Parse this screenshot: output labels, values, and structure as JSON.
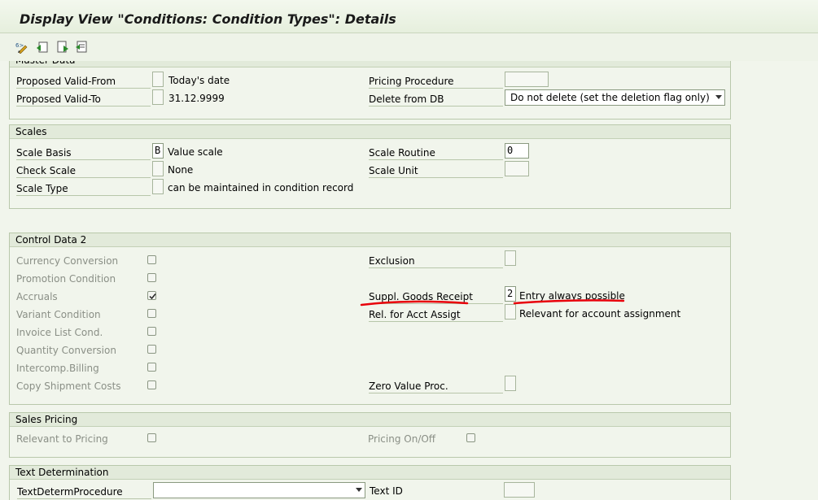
{
  "title": "Display View \"Conditions: Condition Types\": Details",
  "toolbar": {
    "icons": [
      "display-change-icon",
      "undo-icon",
      "next-entry-icon",
      "previous-entry-icon"
    ]
  },
  "master_data": {
    "header": "Master Data",
    "proposed_valid_from": {
      "label": "Proposed Valid-From",
      "value": "",
      "text": "Today's date"
    },
    "proposed_valid_to": {
      "label": "Proposed Valid-To",
      "value": "",
      "text": "31.12.9999"
    },
    "pricing_procedure": {
      "label": "Pricing Procedure",
      "value": ""
    },
    "delete_from_db": {
      "label": "Delete from DB",
      "value": "Do not delete (set the deletion flag only)"
    }
  },
  "scales": {
    "header": "Scales",
    "scale_basis": {
      "label": "Scale Basis",
      "value": "B",
      "text": "Value scale"
    },
    "check_scale": {
      "label": "Check Scale",
      "value": "",
      "text": "None"
    },
    "scale_type": {
      "label": "Scale Type",
      "value": "",
      "text": "can be maintained in condition record"
    },
    "scale_routine": {
      "label": "Scale Routine",
      "value": "0"
    },
    "scale_unit": {
      "label": "Scale Unit",
      "value": ""
    }
  },
  "control_data_2": {
    "header": "Control Data 2",
    "checkboxes": [
      {
        "label": "Currency Conversion",
        "checked": false
      },
      {
        "label": "Promotion Condition",
        "checked": false
      },
      {
        "label": "Accruals",
        "checked": true
      },
      {
        "label": "Variant Condition",
        "checked": false
      },
      {
        "label": "Invoice List Cond.",
        "checked": false
      },
      {
        "label": "Quantity Conversion",
        "checked": false
      },
      {
        "label": "Intercomp.Billing",
        "checked": false
      },
      {
        "label": "Copy Shipment Costs",
        "checked": false
      }
    ],
    "exclusion": {
      "label": "Exclusion",
      "value": ""
    },
    "suppl_goods_receipt": {
      "label": "Suppl. Goods Receipt",
      "value": "2",
      "text": "Entry always possible"
    },
    "rel_acct_assigt": {
      "label": "Rel. for Acct Assigt",
      "value": "",
      "text": "Relevant for account assignment"
    },
    "zero_value_proc": {
      "label": "Zero Value Proc.",
      "value": ""
    },
    "annotation_color": "#e8000a"
  },
  "sales_pricing": {
    "header": "Sales Pricing",
    "relevant_to_pricing": {
      "label": "Relevant to Pricing",
      "checked": false
    },
    "pricing_on_off": {
      "label": "Pricing On/Off",
      "checked": false
    }
  },
  "text_determination": {
    "header": "Text Determination",
    "text_determ_procedure": {
      "label": "TextDetermProcedure",
      "value": ""
    },
    "text_id": {
      "label": "Text ID",
      "value": ""
    }
  }
}
